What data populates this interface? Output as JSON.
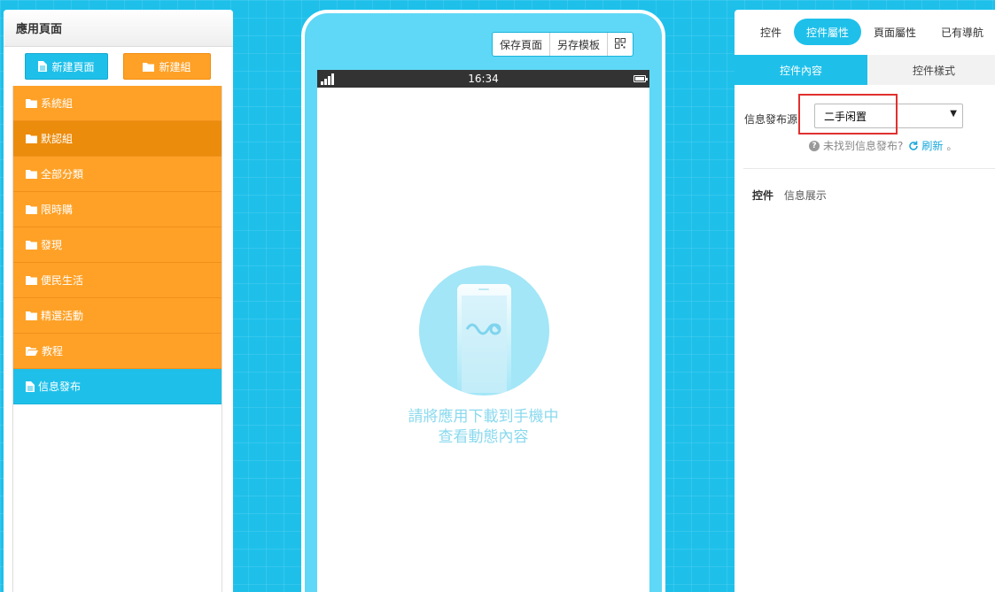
{
  "left": {
    "title": "應用頁面",
    "new_page_label": "新建頁面",
    "new_group_label": "新建組",
    "items": [
      {
        "label": "系統組"
      },
      {
        "label": "默認組"
      },
      {
        "label": "全部分類"
      },
      {
        "label": "限時購"
      },
      {
        "label": "發現"
      },
      {
        "label": "便民生活"
      },
      {
        "label": "精選活動"
      },
      {
        "label": "教程"
      },
      {
        "label": "信息發布"
      }
    ]
  },
  "phone": {
    "toolbar": {
      "save_page_label": "保存頁面",
      "save_template_label": "另存模板"
    },
    "status_time": "16:34",
    "placeholder_line1": "請將應用下載到手機中",
    "placeholder_line2": "查看動態內容"
  },
  "right": {
    "tabs": [
      "控件",
      "控件屬性",
      "頁面屬性",
      "已有導航"
    ],
    "sub_tabs": [
      "控件內容",
      "控件樣式"
    ],
    "source_label": "信息發布源",
    "source_value": "二手闲置",
    "help_text": "未找到信息發布?",
    "refresh_label": "刷新",
    "refresh_suffix": "。",
    "control_key": "控件",
    "control_value": "信息展示"
  },
  "colors": {
    "accent_blue": "#1ec0ea",
    "group_orange": "#ffa126",
    "group_orange_active": "#ec8c0c",
    "highlight_red": "#e0312f"
  }
}
